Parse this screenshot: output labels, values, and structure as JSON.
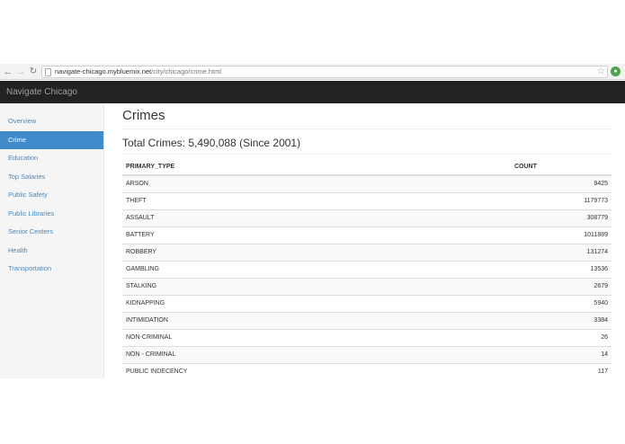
{
  "browser": {
    "url_host": "navigate-chicago.mybluemix.net",
    "url_path": "/city/chicago/crime.html"
  },
  "navbar": {
    "brand": "Navigate Chicago"
  },
  "sidebar": {
    "items": [
      {
        "label": "Overview",
        "active": false
      },
      {
        "label": "Crime",
        "active": true
      },
      {
        "label": "Education",
        "active": false
      },
      {
        "label": "Top Salaries",
        "active": false
      },
      {
        "label": "Public Safety",
        "active": false
      },
      {
        "label": "Public Libraries",
        "active": false
      },
      {
        "label": "Senior Centers",
        "active": false
      },
      {
        "label": "Health",
        "active": false
      },
      {
        "label": "Transportation",
        "active": false
      }
    ]
  },
  "main": {
    "title": "Crimes",
    "subtitle": "Total Crimes: 5,490,088 (Since 2001)",
    "table": {
      "headers": [
        "PRIMARY_TYPE",
        "COUNT"
      ],
      "rows": [
        [
          "ARSON",
          "9425"
        ],
        [
          "THEFT",
          "1179773"
        ],
        [
          "ASSAULT",
          "308779"
        ],
        [
          "BATTERY",
          "1011889"
        ],
        [
          "ROBBERY",
          "131274"
        ],
        [
          "GAMBLING",
          "13536"
        ],
        [
          "STALKING",
          "2679"
        ],
        [
          "KIDNAPPING",
          "5940"
        ],
        [
          "INTIMIDATION",
          "3384"
        ],
        [
          "NON-CRIMINAL",
          "26"
        ],
        [
          "NON - CRIMINAL",
          "14"
        ],
        [
          "PUBLIC INDECENCY",
          "117"
        ]
      ]
    }
  },
  "colors": {
    "navbar_bg": "#222222",
    "link": "#428bca",
    "active_bg": "#428bca",
    "sidebar_bg": "#f5f5f5"
  }
}
